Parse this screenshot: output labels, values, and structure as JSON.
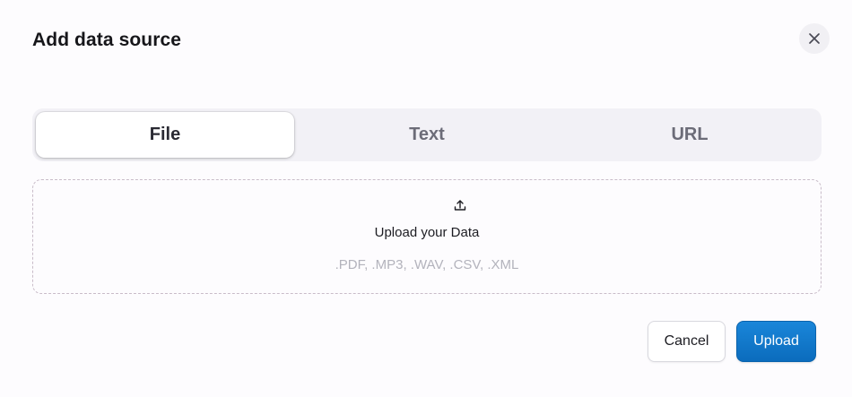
{
  "dialog": {
    "title": "Add data source",
    "close_icon": "close-icon"
  },
  "tabs": [
    {
      "label": "File",
      "active": true
    },
    {
      "label": "Text",
      "active": false
    },
    {
      "label": "URL",
      "active": false
    }
  ],
  "dropzone": {
    "icon": "upload-icon",
    "title": "Upload your Data",
    "formats": ".PDF, .MP3, .WAV, .CSV, .XML"
  },
  "actions": {
    "cancel_label": "Cancel",
    "upload_label": "Upload"
  },
  "colors": {
    "accent": "#0b6cbd",
    "tab_bar_bg": "#f2f1f6",
    "dropzone_border": "#c9bcc9"
  }
}
